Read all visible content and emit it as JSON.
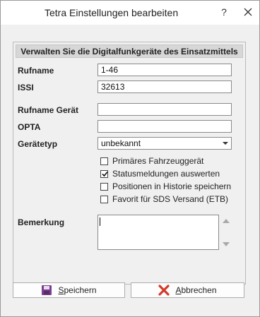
{
  "window": {
    "title": "Tetra Einstellungen bearbeiten",
    "help": "?"
  },
  "group": {
    "header": "Verwalten Sie die Digitalfunkgeräte des Einsatzmittels"
  },
  "form": {
    "rufname": {
      "label": "Rufname",
      "value": "1-46"
    },
    "issi": {
      "label": "ISSI",
      "value": "32613"
    },
    "rufname_geraet": {
      "label": "Rufname Gerät",
      "value": ""
    },
    "opta": {
      "label": "OPTA",
      "value": ""
    },
    "geraetetyp": {
      "label": "Gerätetyp",
      "value": "unbekannt"
    },
    "checkboxes": [
      {
        "label": "Primäres Fahrzeuggerät",
        "checked": false
      },
      {
        "label": "Statusmeldungen auswerten",
        "checked": true
      },
      {
        "label": "Positionen in Historie speichern",
        "checked": false
      },
      {
        "label": "Favorit für SDS Versand (ETB)",
        "checked": false
      }
    ],
    "bemerkung": {
      "label": "Bemerkung",
      "value": ""
    }
  },
  "buttons": {
    "save_access": "S",
    "save_rest": "peichern",
    "cancel_access": "A",
    "cancel_rest": "bbrechen"
  },
  "colors": {
    "save_icon": "#7b3f8f",
    "cancel_icon": "#d23a2a",
    "header_bg": "#d7d7d7"
  }
}
